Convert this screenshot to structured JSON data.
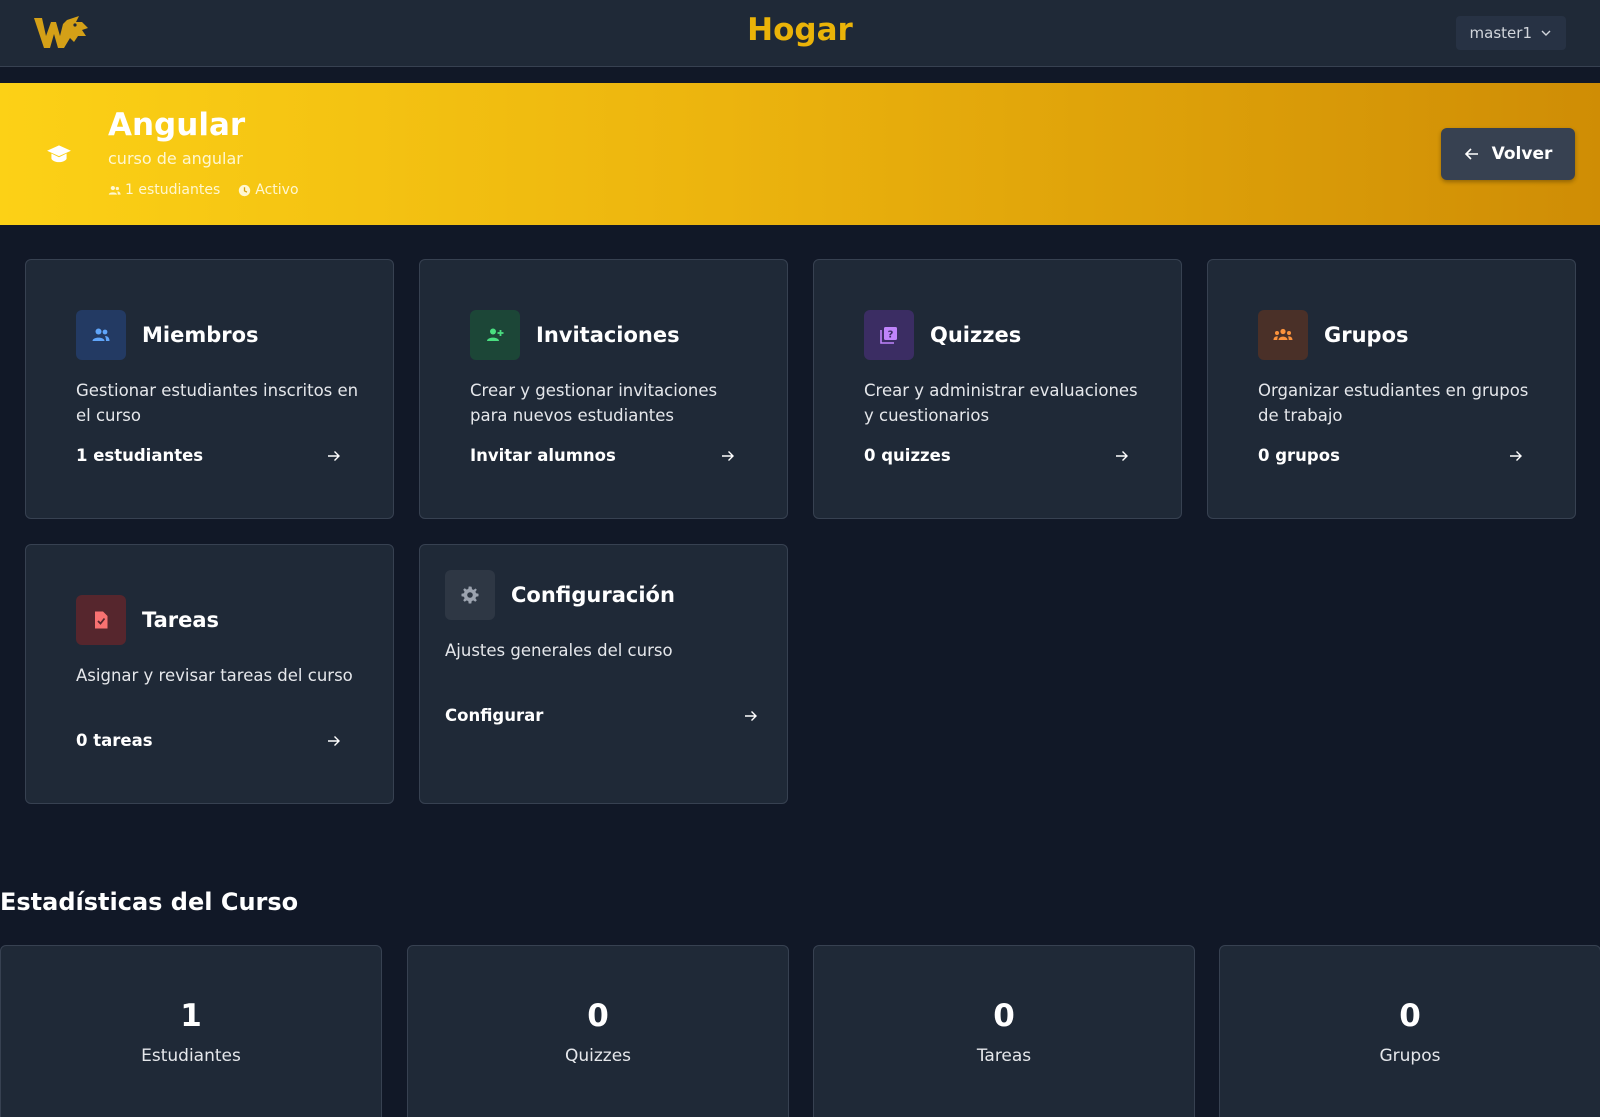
{
  "header": {
    "title": "Hogar",
    "user": "master1"
  },
  "course": {
    "title": "Angular",
    "subtitle": "curso de angular",
    "students_meta": "1 estudiantes",
    "status": "Activo",
    "back_label": "Volver"
  },
  "cards": [
    {
      "title": "Miembros",
      "description": "Gestionar estudiantes inscritos en el curso",
      "action": "1 estudiantes",
      "icon": "users-icon",
      "icon_bg": "#233a63",
      "icon_color": "#60a5fa"
    },
    {
      "title": "Invitaciones",
      "description": "Crear y gestionar invitaciones para nuevos estudiantes",
      "action": "Invitar alumnos",
      "icon": "user-plus-icon",
      "icon_bg": "#1c4637",
      "icon_color": "#4ade80"
    },
    {
      "title": "Quizzes",
      "description": "Crear y administrar evaluaciones y cuestionarios",
      "action": "0 quizzes",
      "icon": "quiz-icon",
      "icon_bg": "#3b2d63",
      "icon_color": "#c084fc"
    },
    {
      "title": "Grupos",
      "description": "Organizar estudiantes en grupos de trabajo",
      "action": "0 grupos",
      "icon": "group-icon",
      "icon_bg": "#4a3028",
      "icon_color": "#fb923c"
    },
    {
      "title": "Tareas",
      "description": "Asignar y revisar tareas del curso",
      "action": "0 tareas",
      "icon": "task-file-icon",
      "icon_bg": "#56262d",
      "icon_color": "#f87171"
    },
    {
      "title": "Configuración",
      "description": "Ajustes generales del curso",
      "action": "Configurar",
      "icon": "gear-icon",
      "icon_bg": "#2e3744",
      "icon_color": "#9ca3af"
    }
  ],
  "stats": {
    "title": "Estadísticas del Curso",
    "items": [
      {
        "value": "1",
        "label": "Estudiantes"
      },
      {
        "value": "0",
        "label": "Quizzes"
      },
      {
        "value": "0",
        "label": "Tareas"
      },
      {
        "value": "0",
        "label": "Grupos"
      }
    ]
  },
  "colors": {
    "accent": "#eab308",
    "background": "#111827",
    "card": "#1f2937"
  }
}
